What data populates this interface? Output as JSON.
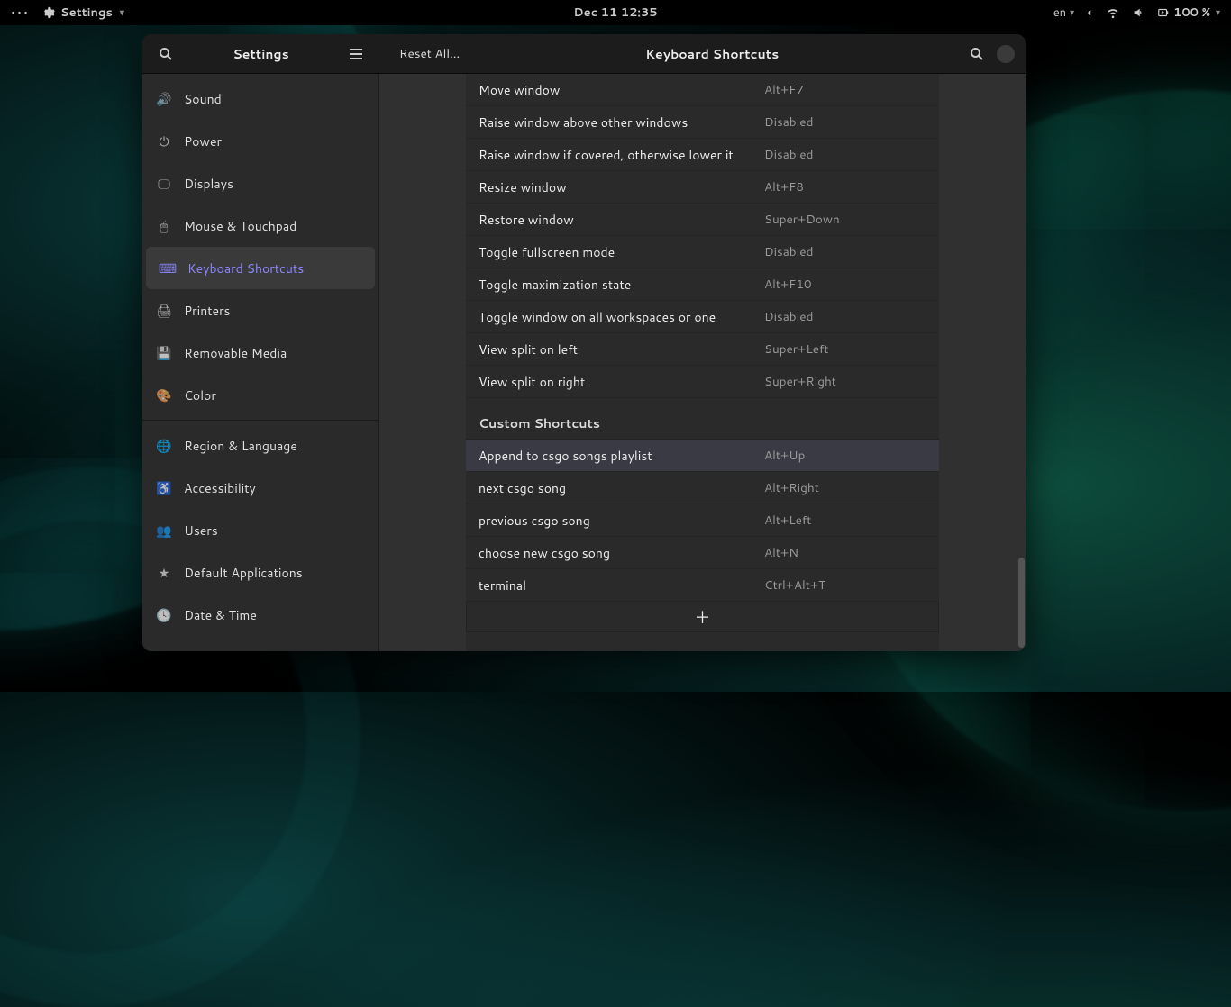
{
  "topbar": {
    "settings_label": "Settings",
    "clock": "Dec 11  12:35",
    "lang": "en",
    "battery": "100 %"
  },
  "window": {
    "left_title": "Settings",
    "reset_label": "Reset All…",
    "page_title": "Keyboard Shortcuts"
  },
  "sidebar": {
    "items": [
      {
        "id": "sound",
        "label": "Sound",
        "icon": "🔊"
      },
      {
        "id": "power",
        "label": "Power",
        "icon": "⏻"
      },
      {
        "id": "displays",
        "label": "Displays",
        "icon": "🖵"
      },
      {
        "id": "mouse",
        "label": "Mouse & Touchpad",
        "icon": "🖱"
      },
      {
        "id": "keyboard",
        "label": "Keyboard Shortcuts",
        "icon": "⌨",
        "selected": true
      },
      {
        "id": "printers",
        "label": "Printers",
        "icon": "🖨"
      },
      {
        "id": "removable",
        "label": "Removable Media",
        "icon": "💾"
      },
      {
        "id": "color",
        "label": "Color",
        "icon": "🎨"
      },
      {
        "id": "sep",
        "sep": true
      },
      {
        "id": "region",
        "label": "Region & Language",
        "icon": "🌐"
      },
      {
        "id": "accessibility",
        "label": "Accessibility",
        "icon": "♿"
      },
      {
        "id": "users",
        "label": "Users",
        "icon": "👥"
      },
      {
        "id": "default-apps",
        "label": "Default Applications",
        "icon": "★"
      },
      {
        "id": "datetime",
        "label": "Date & Time",
        "icon": "🕓"
      }
    ]
  },
  "shortcuts": {
    "window_rows": [
      {
        "label": "Move window",
        "accel": "Alt+F7"
      },
      {
        "label": "Raise window above other windows",
        "accel": "Disabled"
      },
      {
        "label": "Raise window if covered, otherwise lower it",
        "accel": "Disabled"
      },
      {
        "label": "Resize window",
        "accel": "Alt+F8"
      },
      {
        "label": "Restore window",
        "accel": "Super+Down"
      },
      {
        "label": "Toggle fullscreen mode",
        "accel": "Disabled"
      },
      {
        "label": "Toggle maximization state",
        "accel": "Alt+F10"
      },
      {
        "label": "Toggle window on all workspaces or one",
        "accel": "Disabled"
      },
      {
        "label": "View split on left",
        "accel": "Super+Left"
      },
      {
        "label": "View split on right",
        "accel": "Super+Right"
      }
    ],
    "custom_header": "Custom Shortcuts",
    "custom_rows": [
      {
        "label": "Append to csgo songs playlist",
        "accel": "Alt+Up",
        "selected": true
      },
      {
        "label": "next csgo song",
        "accel": "Alt+Right"
      },
      {
        "label": "previous csgo song",
        "accel": "Alt+Left"
      },
      {
        "label": "choose new csgo song",
        "accel": "Alt+N"
      },
      {
        "label": "terminal",
        "accel": "Ctrl+Alt+T"
      }
    ]
  }
}
